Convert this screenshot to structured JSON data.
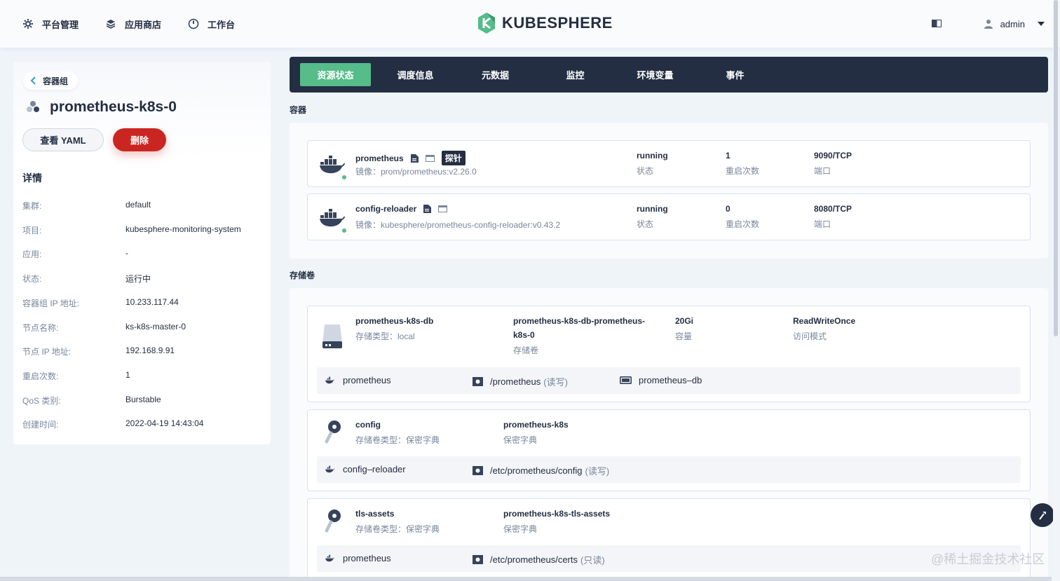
{
  "nav": {
    "platform": "平台管理",
    "appstore": "应用商店",
    "workbench": "工作台",
    "logo": "KUBESPHERE",
    "user": "admin"
  },
  "left": {
    "back_label": "容器组",
    "pod_name": "prometheus-k8s-0",
    "yaml_label": "查看 YAML",
    "delete_label": "删除",
    "details_title": "详情",
    "details": [
      {
        "k": "集群:",
        "v": "default"
      },
      {
        "k": "项目:",
        "v": "kubesphere-monitoring-system"
      },
      {
        "k": "应用:",
        "v": "-"
      },
      {
        "k": "状态:",
        "v": "运行中"
      },
      {
        "k": "容器组 IP 地址:",
        "v": "10.233.117.44"
      },
      {
        "k": "节点名称:",
        "v": "ks-k8s-master-0"
      },
      {
        "k": "节点 IP 地址:",
        "v": "192.168.9.91"
      },
      {
        "k": "重启次数:",
        "v": "1"
      },
      {
        "k": "QoS 类别:",
        "v": "Burstable"
      },
      {
        "k": "创建时间:",
        "v": "2022-04-19 14:43:04"
      }
    ]
  },
  "tabs": [
    "资源状态",
    "调度信息",
    "元数据",
    "监控",
    "环境变量",
    "事件"
  ],
  "sections": {
    "containers": "容器",
    "volumes": "存储卷"
  },
  "containers": [
    {
      "name": "prometheus",
      "probe": "探针",
      "image": "镜像：prom/prometheus:v2.26.0",
      "status": "running",
      "status_label": "状态",
      "restarts": "1",
      "restarts_label": "重启次数",
      "port": "9090/TCP",
      "port_label": "端口"
    },
    {
      "name": "config-reloader",
      "image": "镜像：kubesphere/prometheus-config-reloader:v0.43.2",
      "status": "running",
      "status_label": "状态",
      "restarts": "0",
      "restarts_label": "重启次数",
      "port": "8080/TCP",
      "port_label": "端口"
    }
  ],
  "volumes": [
    {
      "name": "prometheus-k8s-db",
      "type": "存储类型：local",
      "pvc_line1": "prometheus-k8s-db-prometheus-",
      "pvc_line2": "k8s-0",
      "pvc_label": "存储卷",
      "capacity": "20Gi",
      "capacity_label": "容量",
      "access": "ReadWriteOnce",
      "access_label": "访问模式",
      "mount": {
        "container": "prometheus",
        "path": "/prometheus",
        "mode": "(读写)",
        "volume": "prometheus–db"
      }
    },
    {
      "name": "config",
      "type": "存储卷类型：保密字典",
      "ref": "prometheus-k8s",
      "ref_label": "保密字典",
      "mount": {
        "container": "config–reloader",
        "path": "/etc/prometheus/config",
        "mode": "(读写)"
      }
    },
    {
      "name": "tls-assets",
      "type": "存储卷类型：保密字典",
      "ref": "prometheus-k8s-tls-assets",
      "ref_label": "保密字典",
      "mount": {
        "container": "prometheus",
        "path": "/etc/prometheus/certs",
        "mode": "(只读)"
      }
    }
  ],
  "watermark": "@稀土掘金技术社区"
}
